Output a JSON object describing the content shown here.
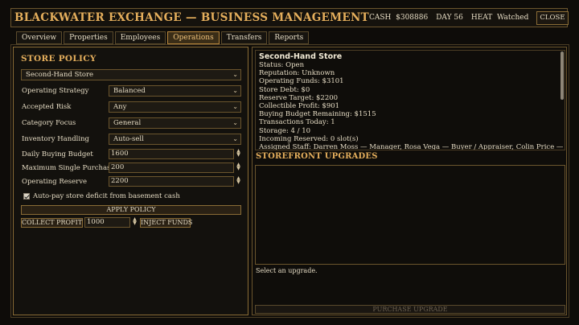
{
  "header": {
    "title": "BLACKWATER EXCHANGE — BUSINESS MANAGEMENT",
    "cash_label": "CASH",
    "cash_value": "$308886",
    "day_label": "DAY",
    "day_value": "56",
    "heat_label": "HEAT",
    "heat_value": "Watched",
    "close_label": "CLOSE"
  },
  "tabs": [
    {
      "label": "Overview",
      "active": false
    },
    {
      "label": "Properties",
      "active": false
    },
    {
      "label": "Employees",
      "active": false
    },
    {
      "label": "Operations",
      "active": true
    },
    {
      "label": "Transfers",
      "active": false
    },
    {
      "label": "Reports",
      "active": false
    }
  ],
  "store_policy": {
    "heading": "STORE POLICY",
    "store_select": "Second-Hand Store",
    "operating_strategy": {
      "label": "Operating Strategy",
      "value": "Balanced"
    },
    "accepted_risk": {
      "label": "Accepted Risk",
      "value": "Any"
    },
    "category_focus": {
      "label": "Category Focus",
      "value": "General"
    },
    "inventory_handling": {
      "label": "Inventory Handling",
      "value": "Auto-sell"
    },
    "daily_buying_budget": {
      "label": "Daily Buying Budget",
      "value": "1600"
    },
    "max_single_purchase": {
      "label": "Maximum Single Purchase",
      "value": "200"
    },
    "operating_reserve": {
      "label": "Operating Reserve",
      "value": "2200"
    },
    "autopay_label": "Auto-pay store deficit from basement cash",
    "autopay_checked": true,
    "apply_label": "APPLY POLICY",
    "collect_label": "COLLECT PROFIT",
    "amount_value": "1000",
    "inject_label": "INJECT FUNDS"
  },
  "store_info": {
    "name": "Second-Hand Store",
    "lines": [
      "Status: Open",
      "Reputation: Unknown",
      "Operating Funds: $3101",
      "Store Debt: $0",
      "Reserve Target: $2200",
      "Collectible Profit: $901",
      "Buying Budget Remaining: $1515",
      "Transactions Today: 1",
      "Storage: 4 / 10",
      "Incoming Reserved: 0 slot(s)",
      "Assigned Staff: Darren Moss — Manager, Rosa Vega — Buyer / Appraiser, Colin Price —"
    ]
  },
  "upgrades": {
    "heading": "STOREFRONT UPGRADES",
    "hint": "Select an upgrade.",
    "purchase_label": "PURCHASE UPGRADE"
  }
}
